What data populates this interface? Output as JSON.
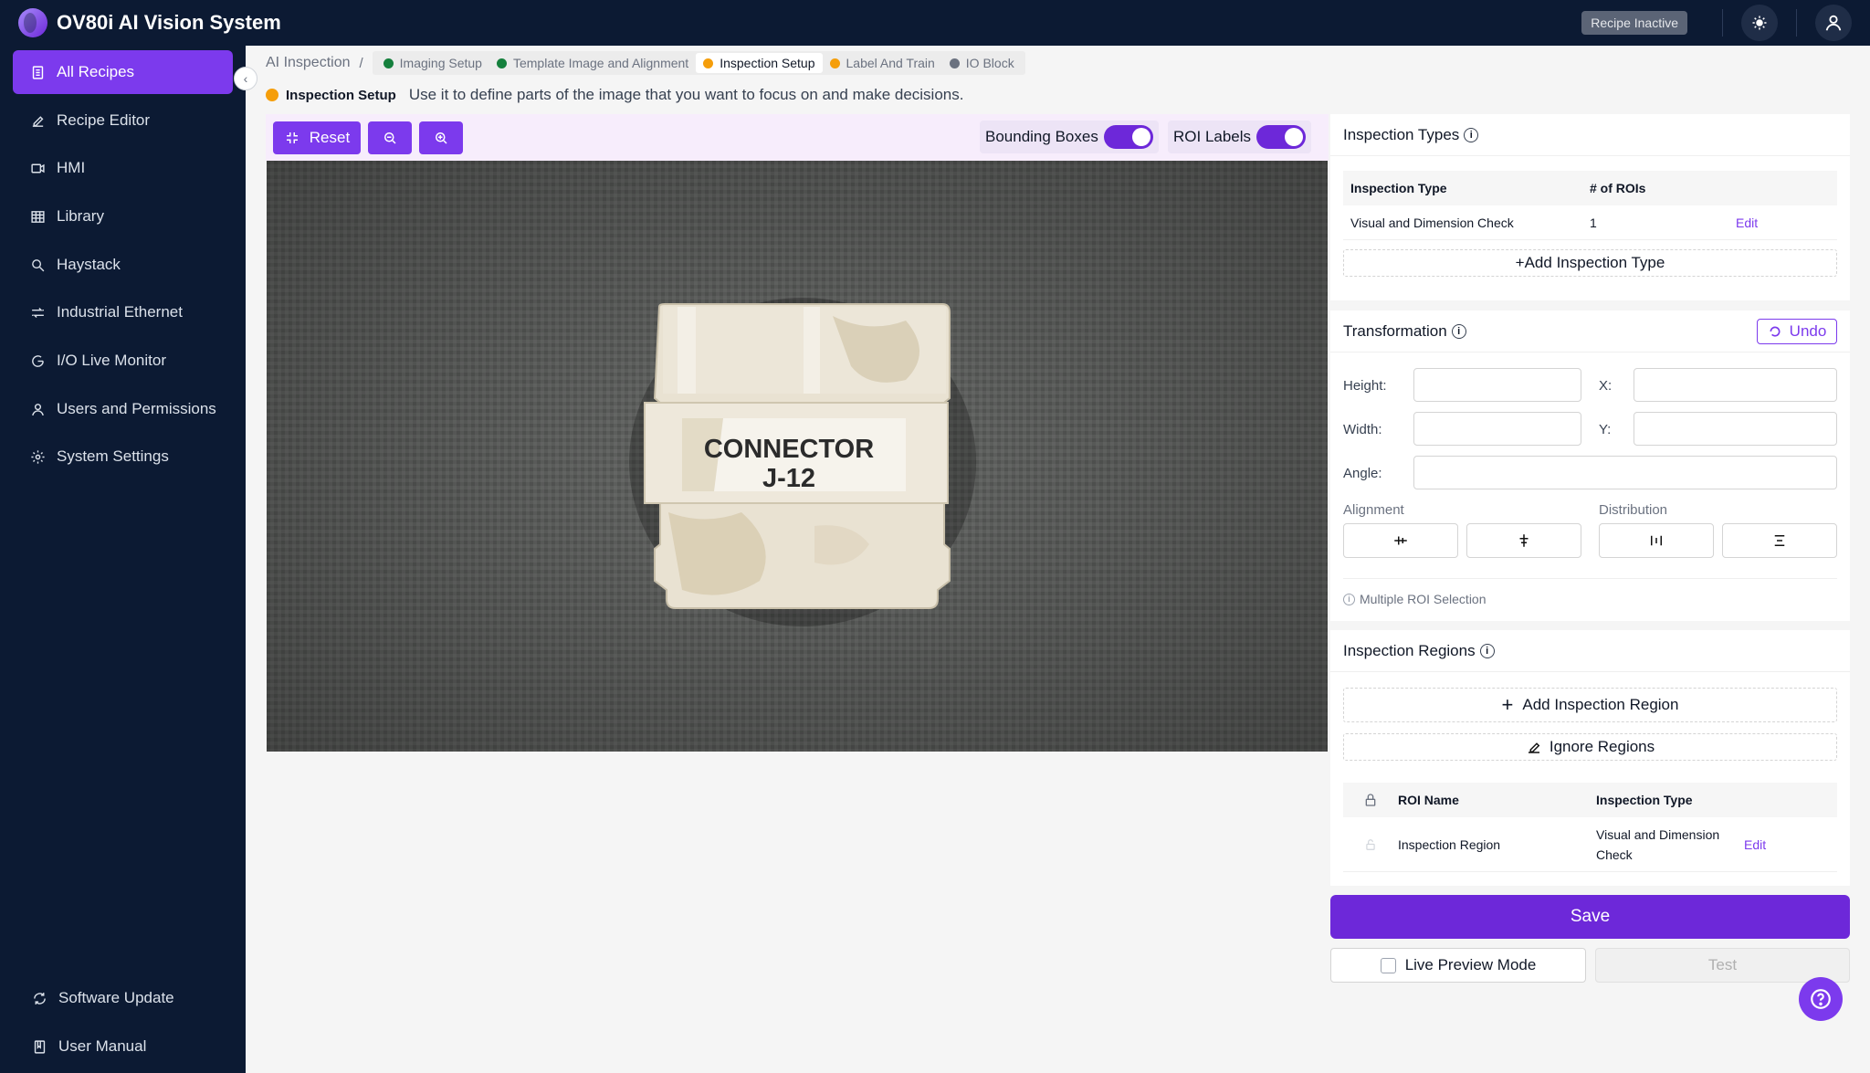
{
  "app": {
    "title": "OV80i AI Vision System",
    "status": "Recipe Inactive"
  },
  "sidebar": {
    "items": [
      {
        "label": "All Recipes",
        "icon": "document-icon"
      },
      {
        "label": "Recipe Editor",
        "icon": "pencil-icon"
      },
      {
        "label": "HMI",
        "icon": "video-icon"
      },
      {
        "label": "Library",
        "icon": "grid-icon"
      },
      {
        "label": "Haystack",
        "icon": "search-icon"
      },
      {
        "label": "Industrial Ethernet",
        "icon": "ethernet-icon"
      },
      {
        "label": "I/O Live Monitor",
        "icon": "monitor-icon"
      },
      {
        "label": "Users and Permissions",
        "icon": "user-icon"
      },
      {
        "label": "System Settings",
        "icon": "gear-icon"
      }
    ],
    "bottom": [
      {
        "label": "Software Update",
        "icon": "refresh-icon"
      },
      {
        "label": "User Manual",
        "icon": "book-icon"
      }
    ]
  },
  "breadcrumb": {
    "root": "AI Inspection",
    "steps": [
      {
        "label": "Imaging Setup",
        "color": "#15803d"
      },
      {
        "label": "Template Image and Alignment",
        "color": "#15803d"
      },
      {
        "label": "Inspection Setup",
        "color": "#f59e0b"
      },
      {
        "label": "Label And Train",
        "color": "#f59e0b"
      },
      {
        "label": "IO Block",
        "color": "#6b7280"
      }
    ]
  },
  "page": {
    "title": "Inspection Setup",
    "description": "Use it to define parts of the image that you want to focus on and make decisions."
  },
  "toolbar": {
    "reset": "Reset",
    "bounding_boxes": "Bounding Boxes",
    "roi_labels": "ROI Labels"
  },
  "image": {
    "label_line1": "CONNECTOR",
    "label_line2": "J-12"
  },
  "inspection_types": {
    "title": "Inspection Types",
    "col_type": "Inspection Type",
    "col_rois": "# of ROIs",
    "rows": [
      {
        "type": "Visual and Dimension Check",
        "rois": "1",
        "action": "Edit"
      }
    ],
    "add": "Add Inspection Type"
  },
  "transformation": {
    "title": "Transformation",
    "undo": "Undo",
    "height": "Height:",
    "x": "X:",
    "width": "Width:",
    "y": "Y:",
    "angle": "Angle:",
    "alignment": "Alignment",
    "distribution": "Distribution",
    "multi_roi": "Multiple ROI Selection"
  },
  "regions": {
    "title": "Inspection Regions",
    "add": "Add Inspection Region",
    "ignore": "Ignore Regions",
    "col_name": "ROI Name",
    "col_type": "Inspection Type",
    "rows": [
      {
        "name": "Inspection Region",
        "type_line1": "Visual and Dimension",
        "type_line2": "Check",
        "action": "Edit"
      }
    ]
  },
  "actions": {
    "save": "Save",
    "live_preview": "Live Preview Mode",
    "test": "Test"
  }
}
